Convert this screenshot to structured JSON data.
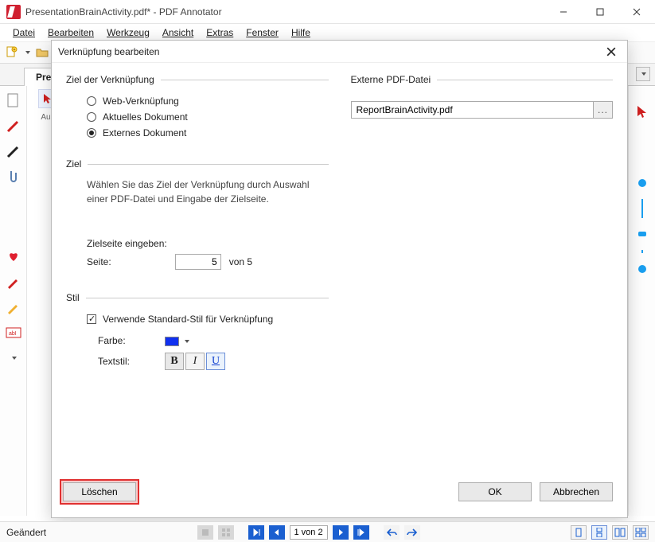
{
  "window": {
    "title": "PresentationBrainActivity.pdf* - PDF Annotator"
  },
  "menubar": {
    "items": [
      "Datei",
      "Bearbeiten",
      "Werkzeug",
      "Ansicht",
      "Extras",
      "Fenster",
      "Hilfe"
    ]
  },
  "doctab": {
    "label": "Prese"
  },
  "left2": {
    "selection_label": "Aus"
  },
  "dialog": {
    "title": "Verknüpfung bearbeiten",
    "group_linktarget": "Ziel der Verknüpfung",
    "radio_web": "Web-Verknüpfung",
    "radio_current": "Aktuelles Dokument",
    "radio_external": "Externes Dokument",
    "group_target": "Ziel",
    "target_help": "Wählen Sie das Ziel der Verknüpfung durch Auswahl einer PDF-Datei und Eingabe der Zielseite.",
    "targetpage_label": "Zielseite eingeben:",
    "page_label": "Seite:",
    "page_value": "5",
    "page_suffix": "von 5",
    "group_style": "Stil",
    "use_default_style": "Verwende Standard-Stil für Verknüpfung",
    "color_label": "Farbe:",
    "textstyle_label": "Textstil:",
    "style_color": "#1030f0",
    "group_external": "Externe PDF-Datei",
    "external_path": "ReportBrainActivity.pdf",
    "browse_label": "...",
    "btn_delete": "Löschen",
    "btn_ok": "OK",
    "btn_cancel": "Abbrechen"
  },
  "statusbar": {
    "changed": "Geändert",
    "page_field": "1 von 2"
  }
}
